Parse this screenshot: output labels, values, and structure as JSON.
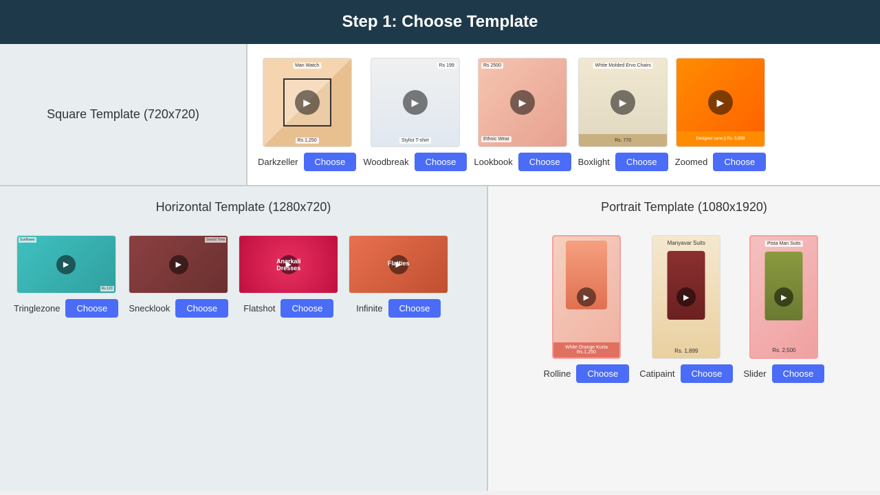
{
  "header": {
    "title": "Step 1: Choose Template"
  },
  "squareSection": {
    "label": "Square Template (720x720)",
    "templates": [
      {
        "id": "darkzeller",
        "name": "Darkzeller",
        "priceLabel": "Rs 1,250",
        "topLabel": "Man Watch"
      },
      {
        "id": "woodbreak",
        "name": "Woodbreak",
        "priceLabel": "Stylist T-shirt",
        "topLabel": "Rs 199"
      },
      {
        "id": "lookbook",
        "name": "Lookbook",
        "priceLabel": "Ethnic Wear",
        "topLabel": "Rs 2500"
      },
      {
        "id": "boxlight",
        "name": "Boxlight",
        "priceLabel": "Rs. 770",
        "topLabel": "White Molded Ervo Chairs"
      },
      {
        "id": "zoomed",
        "name": "Zoomed",
        "priceLabel": "Designer cane || Rs. 5,999",
        "topLabel": ""
      }
    ],
    "chooseLabel": "Choose"
  },
  "horizontalSection": {
    "label": "Horizontal Template (1280x720)",
    "templates": [
      {
        "id": "tringlezone",
        "name": "Tringlezone"
      },
      {
        "id": "snecklook",
        "name": "Snecklook"
      },
      {
        "id": "flatshot",
        "name": "Flatshot",
        "overlayText": "Anarkali Dresses"
      },
      {
        "id": "infinite",
        "name": "Infinite",
        "overlayText": "Flatties"
      }
    ],
    "chooseLabel": "Choose"
  },
  "portraitSection": {
    "label": "Portrait Template (1080x1920)",
    "templates": [
      {
        "id": "rolline",
        "name": "Rolline",
        "productName": "White Orange Kurta",
        "price": "Rs.1,250"
      },
      {
        "id": "catipaint",
        "name": "Catipaint",
        "productName": "Manyavar Suits",
        "price": "Rs. 1,899"
      },
      {
        "id": "slider",
        "name": "Slider",
        "productName": "Pista Man Suits",
        "price": "Rs. 2,500"
      }
    ],
    "chooseLabel": "Choose"
  }
}
